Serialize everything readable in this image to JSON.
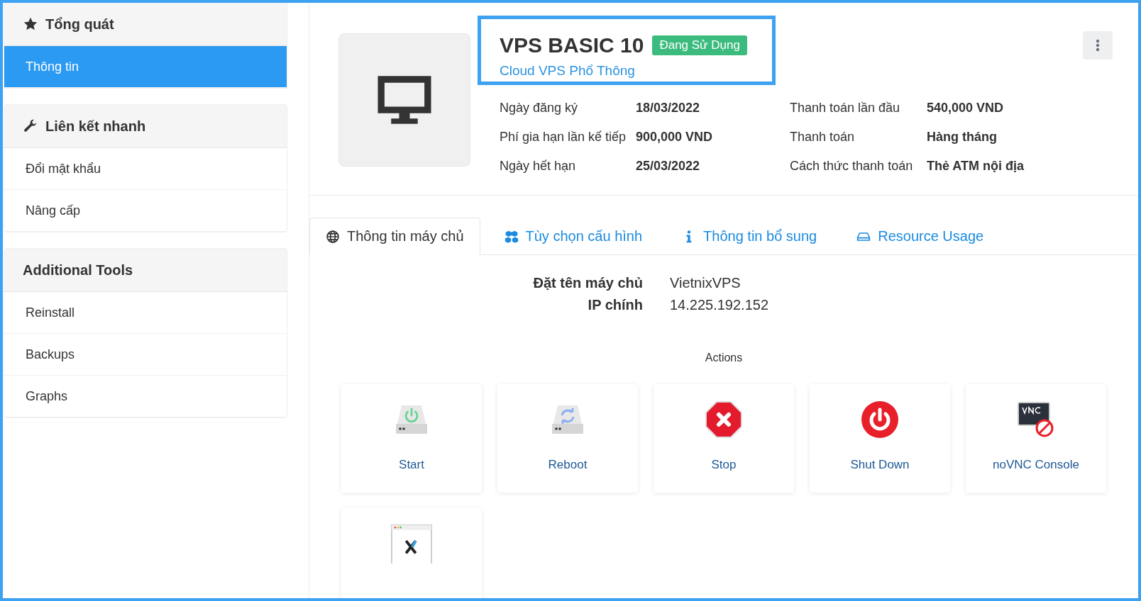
{
  "sidebar": {
    "sections": [
      {
        "title": "Tổng quát",
        "kind": "star",
        "items": [
          {
            "label": "Thông tin",
            "selected": true
          }
        ]
      },
      {
        "title": "Liên kết nhanh",
        "kind": "wrench",
        "items": [
          {
            "label": "Đổi mật khẩu",
            "selected": false
          },
          {
            "label": "Nâng cấp",
            "selected": false
          }
        ]
      },
      {
        "title": "Additional Tools",
        "kind": "plain",
        "items": [
          {
            "label": "Reinstall",
            "selected": false
          },
          {
            "label": "Backups",
            "selected": false
          },
          {
            "label": "Graphs",
            "selected": false
          }
        ]
      }
    ]
  },
  "product": {
    "title": "VPS BASIC 10",
    "status": "Đang Sử Dụng",
    "subtitle": "Cloud VPS Phổ Thông",
    "details": [
      {
        "label": "Ngày đăng ký",
        "value": "18/03/2022"
      },
      {
        "label": "Thanh toán lần đầu",
        "value": "540,000 VND"
      },
      {
        "label": "Phí gia hạn lần kế tiếp",
        "value": "900,000 VND"
      },
      {
        "label": "Thanh toán",
        "value": "Hàng tháng"
      },
      {
        "label": "Ngày hết hạn",
        "value": "25/03/2022"
      },
      {
        "label": "Cách thức thanh toán",
        "value": "Thẻ ATM nội địa"
      }
    ]
  },
  "tabs": [
    {
      "label": "Thông tin máy chủ",
      "kind": "globe",
      "selected": true
    },
    {
      "label": "Tùy chọn cấu hình",
      "kind": "cubes",
      "selected": false
    },
    {
      "label": "Thông tin bổ sung",
      "kind": "info",
      "selected": false
    },
    {
      "label": "Resource Usage",
      "kind": "drive",
      "selected": false
    }
  ],
  "server_info": [
    {
      "label": "Đặt tên máy chủ",
      "value": "VietnixVPS"
    },
    {
      "label": "IP chính",
      "value": "14.225.192.152"
    }
  ],
  "actions_heading": "Actions",
  "actions": [
    {
      "kind": "start",
      "label": "Start"
    },
    {
      "kind": "reboot",
      "label": "Reboot"
    },
    {
      "kind": "stop",
      "label": "Stop"
    },
    {
      "kind": "shutdown",
      "label": "Shut Down"
    },
    {
      "kind": "vnc",
      "label": "noVNC Console"
    },
    {
      "kind": "browser"
    }
  ]
}
